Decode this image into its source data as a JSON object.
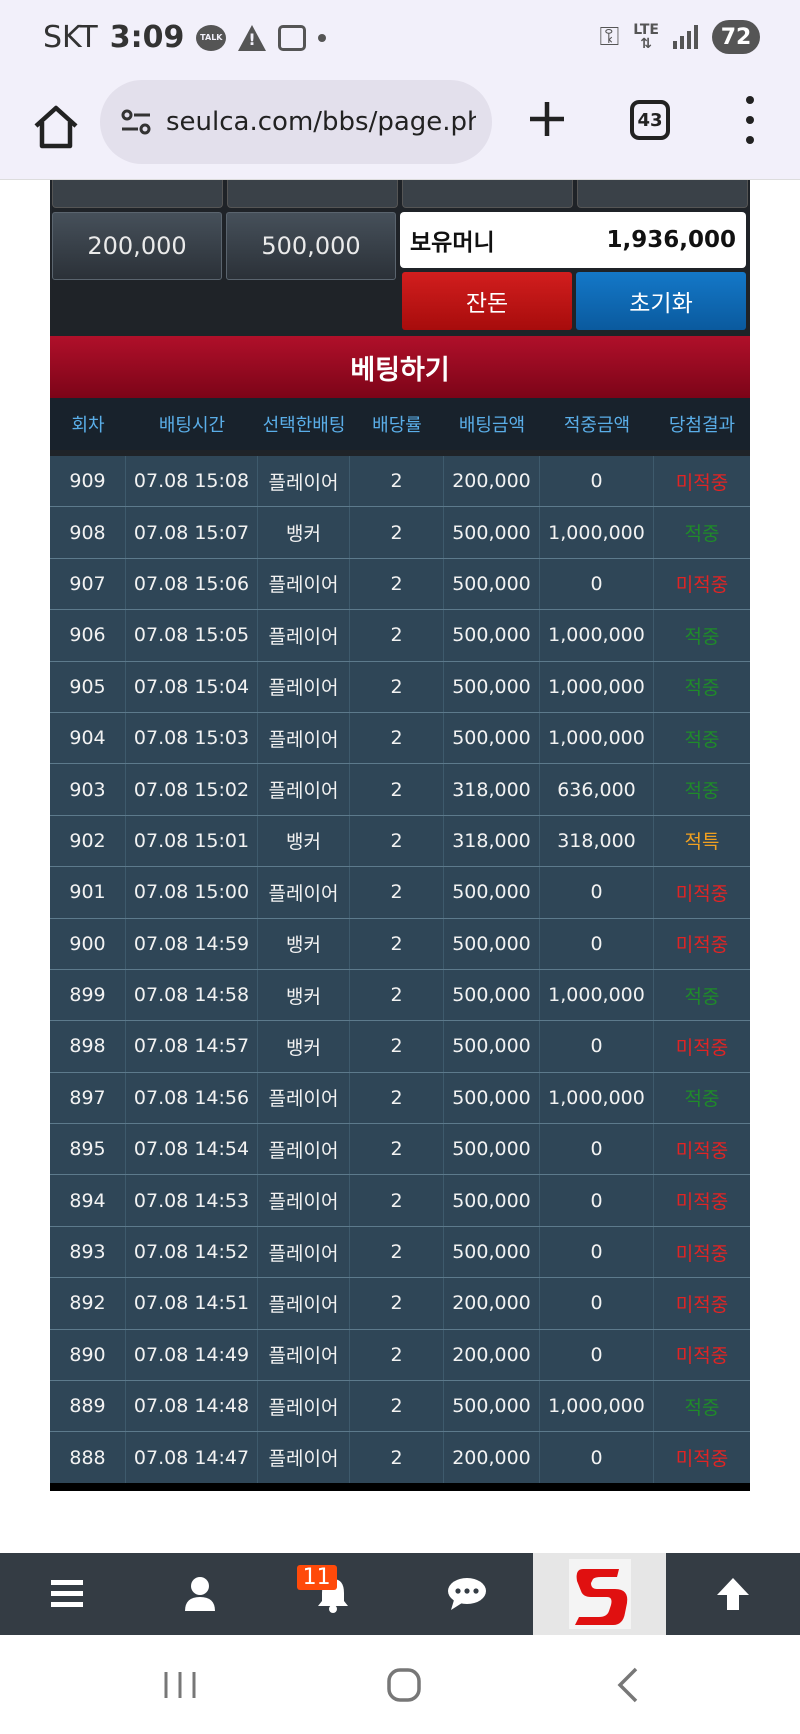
{
  "status_bar": {
    "carrier": "SKT",
    "time": "3:09",
    "talk_icon_text": "TALK",
    "network": "LTE",
    "battery": "72"
  },
  "browser": {
    "url": "seulca.com/bbs/page.php",
    "tab_count": "43"
  },
  "betting_panel": {
    "chip_buttons": [
      "200,000",
      "500,000"
    ],
    "balance_label": "보유머니",
    "balance_value": "1,936,000",
    "change_button": "잔돈",
    "reset_button": "초기화",
    "header": "베팅하기"
  },
  "table": {
    "columns": [
      "회차",
      "배팅시간",
      "선택한배팅",
      "배당률",
      "배팅금액",
      "적중금액",
      "당첨결과"
    ],
    "rows": [
      [
        "909",
        "07.08 15:08",
        "플레이어",
        "2",
        "200,000",
        "0",
        "미적중",
        "lose"
      ],
      [
        "908",
        "07.08 15:07",
        "뱅커",
        "2",
        "500,000",
        "1,000,000",
        "적중",
        "win"
      ],
      [
        "907",
        "07.08 15:06",
        "플레이어",
        "2",
        "500,000",
        "0",
        "미적중",
        "lose"
      ],
      [
        "906",
        "07.08 15:05",
        "플레이어",
        "2",
        "500,000",
        "1,000,000",
        "적중",
        "win"
      ],
      [
        "905",
        "07.08 15:04",
        "플레이어",
        "2",
        "500,000",
        "1,000,000",
        "적중",
        "win"
      ],
      [
        "904",
        "07.08 15:03",
        "플레이어",
        "2",
        "500,000",
        "1,000,000",
        "적중",
        "win"
      ],
      [
        "903",
        "07.08 15:02",
        "플레이어",
        "2",
        "318,000",
        "636,000",
        "적중",
        "win"
      ],
      [
        "902",
        "07.08 15:01",
        "뱅커",
        "2",
        "318,000",
        "318,000",
        "적특",
        "special"
      ],
      [
        "901",
        "07.08 15:00",
        "플레이어",
        "2",
        "500,000",
        "0",
        "미적중",
        "lose"
      ],
      [
        "900",
        "07.08 14:59",
        "뱅커",
        "2",
        "500,000",
        "0",
        "미적중",
        "lose"
      ],
      [
        "899",
        "07.08 14:58",
        "뱅커",
        "2",
        "500,000",
        "1,000,000",
        "적중",
        "win"
      ],
      [
        "898",
        "07.08 14:57",
        "뱅커",
        "2",
        "500,000",
        "0",
        "미적중",
        "lose"
      ],
      [
        "897",
        "07.08 14:56",
        "플레이어",
        "2",
        "500,000",
        "1,000,000",
        "적중",
        "win"
      ],
      [
        "895",
        "07.08 14:54",
        "플레이어",
        "2",
        "500,000",
        "0",
        "미적중",
        "lose"
      ],
      [
        "894",
        "07.08 14:53",
        "플레이어",
        "2",
        "500,000",
        "0",
        "미적중",
        "lose"
      ],
      [
        "893",
        "07.08 14:52",
        "플레이어",
        "2",
        "500,000",
        "0",
        "미적중",
        "lose"
      ],
      [
        "892",
        "07.08 14:51",
        "플레이어",
        "2",
        "200,000",
        "0",
        "미적중",
        "lose"
      ],
      [
        "890",
        "07.08 14:49",
        "플레이어",
        "2",
        "200,000",
        "0",
        "미적중",
        "lose"
      ],
      [
        "889",
        "07.08 14:48",
        "플레이어",
        "2",
        "500,000",
        "1,000,000",
        "적중",
        "win"
      ],
      [
        "888",
        "07.08 14:47",
        "플레이어",
        "2",
        "200,000",
        "0",
        "미적중",
        "lose"
      ]
    ]
  },
  "app_nav": {
    "notification_count": "11",
    "items": [
      "menu-icon",
      "user-icon",
      "bell-icon",
      "chat-icon",
      "site-logo",
      "arrow-up-icon"
    ]
  },
  "colors": {
    "header_red": "#b0102a",
    "row_bg": "#2f4657",
    "column_head": "#5aaee8",
    "lose": "#e02424",
    "win": "#1f8a2a",
    "special": "#f0a020"
  }
}
